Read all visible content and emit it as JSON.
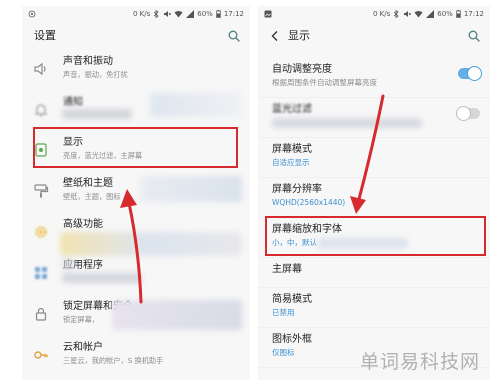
{
  "left_screen": {
    "status": {
      "left_icon": "notification-dot-icon",
      "speed": "0 K/s",
      "battery": "60%",
      "time": "17:12"
    },
    "title": "设置",
    "search_icon": "search-icon",
    "items": [
      {
        "title": "声音和振动",
        "subtitle": "声音，振动，免打扰",
        "icon": "speaker-icon"
      },
      {
        "title": "通知",
        "icon": "bell-icon"
      },
      {
        "title": "显示",
        "subtitle": "亮度，蓝光过滤，主屏幕",
        "icon": "display-icon"
      },
      {
        "title": "壁纸和主题",
        "subtitle": "壁纸，主题，图标",
        "icon": "wallpaper-icon"
      },
      {
        "title": "高级功能",
        "icon": "advanced-features-icon"
      },
      {
        "title": "应用程序",
        "icon": "apps-icon"
      },
      {
        "title": "锁定屏幕和安全",
        "subtitle": "锁定屏幕，",
        "icon": "lock-icon"
      },
      {
        "title": "云和帐户",
        "subtitle": "三星云，我的帐户，S 换机助手",
        "icon": "key-icon"
      }
    ]
  },
  "right_screen": {
    "status": {
      "left_icon": "gallery-icon",
      "speed": "0 K/s",
      "battery": "60%",
      "time": "17:12"
    },
    "title": "显示",
    "back_icon": "back-arrow-icon",
    "search_icon": "search-icon",
    "items": [
      {
        "title": "自动调整亮度",
        "subtitle": "根据周围条件自动调整屏幕亮度",
        "toggle_on": true
      },
      {
        "title": "蓝光过滤",
        "toggle_on": false
      },
      {
        "title": "屏幕模式",
        "subtitle": "自适应显示"
      },
      {
        "title": "屏幕分辨率",
        "subtitle": "WQHD(2560x1440)"
      },
      {
        "title": "屏幕缩放和字体",
        "subtitle": "小，中，默认"
      },
      {
        "title": "主屏幕"
      },
      {
        "title": "简易模式",
        "subtitle": "已禁用"
      },
      {
        "title": "图标外框",
        "subtitle": "仅图标"
      }
    ]
  },
  "watermark": "单词易科技网",
  "colors": {
    "annotation_red": "#d62a2f",
    "toggle_on": "#62b0e6",
    "link_blue": "#3d8fd1",
    "display_icon_green": "#5aab4f",
    "key_icon_orange": "#e3a23a"
  }
}
